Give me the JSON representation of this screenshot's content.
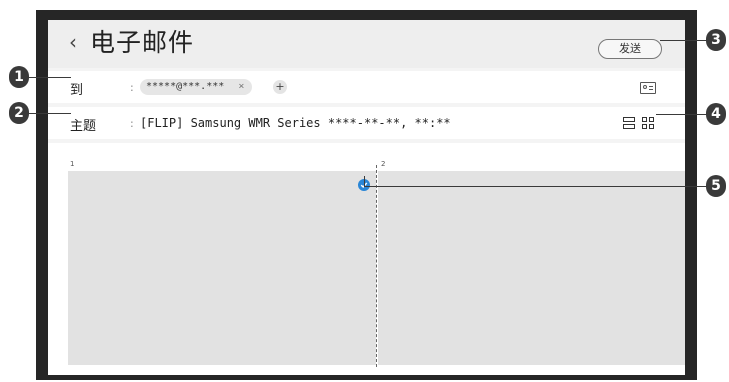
{
  "header": {
    "title": "电子邮件",
    "send_label": "发送"
  },
  "to_row": {
    "label": "到",
    "colon": ":",
    "recipient": "*****@***.***",
    "remove_glyph": "×",
    "add_glyph": "+"
  },
  "subject_row": {
    "label": "主题",
    "colon": ":",
    "value": "[FLIP] Samsung WMR Series ****-**-**, **:**"
  },
  "canvas": {
    "pages": [
      "1",
      "2"
    ]
  },
  "callouts": [
    "1",
    "2",
    "3",
    "4",
    "5"
  ],
  "icons": {
    "back": "back-arrow-icon",
    "contact": "contact-card-icon",
    "layout_single": "single-column-layout-icon",
    "layout_grid": "grid-layout-icon",
    "check": "check-icon"
  },
  "colors": {
    "accent": "#2a86d6",
    "frame": "#262626",
    "page": "#e2e2e2"
  }
}
